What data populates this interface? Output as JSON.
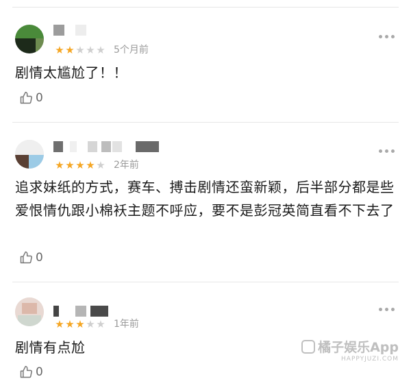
{
  "reviews": [
    {
      "rating": 2,
      "max_rating": 5,
      "time": "5个月前",
      "text": "剧情太尴尬了！！",
      "likes": "0"
    },
    {
      "rating": 4,
      "max_rating": 5,
      "time": "2年前",
      "text": "追求妹纸的方式，赛车、搏击剧情还蛮新颖，后半部分都是些爱恨情仇跟小棉袄主题不呼应，要不是彭冠英简直看不下去了",
      "likes": "0"
    },
    {
      "rating": 3,
      "max_rating": 5,
      "time": "1年前",
      "text": "剧情有点尬",
      "likes": "0"
    }
  ],
  "icons": {
    "like": "thumbs-up-icon",
    "more": "more-dots-icon",
    "star": "star-icon"
  },
  "colors": {
    "star_on": "#f5a623",
    "star_off": "#cfcfcf",
    "time": "#9a9a9a",
    "divider": "#e6e6e6"
  },
  "watermark": {
    "main": "橘子娱乐App",
    "sub": "HAPPYJUZI.COM"
  }
}
